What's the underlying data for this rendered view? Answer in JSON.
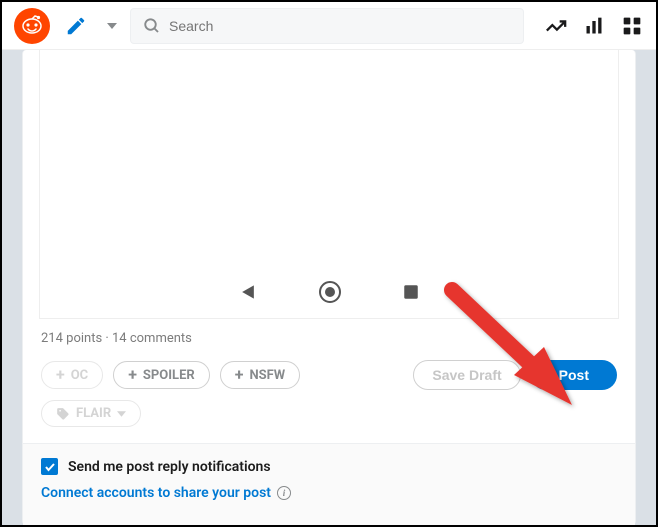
{
  "header": {
    "search_placeholder": "Search"
  },
  "stats_text": "214 points · 14 comments",
  "tags": {
    "oc": "OC",
    "spoiler": "SPOILER",
    "nsfw": "NSFW",
    "flair": "FLAIR"
  },
  "buttons": {
    "save_draft": "Save Draft",
    "post": "Post"
  },
  "notifications": {
    "label": "Send me post reply notifications",
    "connect": "Connect accounts to share your post"
  }
}
